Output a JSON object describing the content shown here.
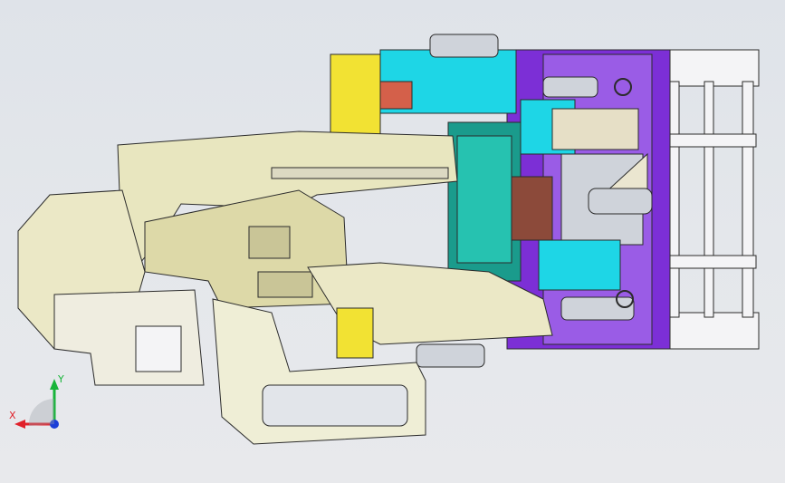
{
  "viewport": {
    "background": "#e2e5ea",
    "model": {
      "colors": {
        "frame": "#e8e6bf",
        "frame_dark": "#c9c597",
        "plate_purple": "#7c2fd6",
        "block_cyan": "#1ed6e6",
        "block_teal": "#1a9b8c",
        "block_yellow": "#f2e233",
        "block_red": "#d4604a",
        "block_brown": "#8c4a3a",
        "steel": "#cfd3da",
        "steel_dark": "#7f8690",
        "rail_white": "#f4f4f6",
        "outline": "#2b2b2b"
      }
    },
    "triad": {
      "x_label": "X",
      "y_label": "Y",
      "x_color": "#e0202a",
      "y_color": "#18b43a",
      "z_color": "#1c3fd8"
    }
  }
}
